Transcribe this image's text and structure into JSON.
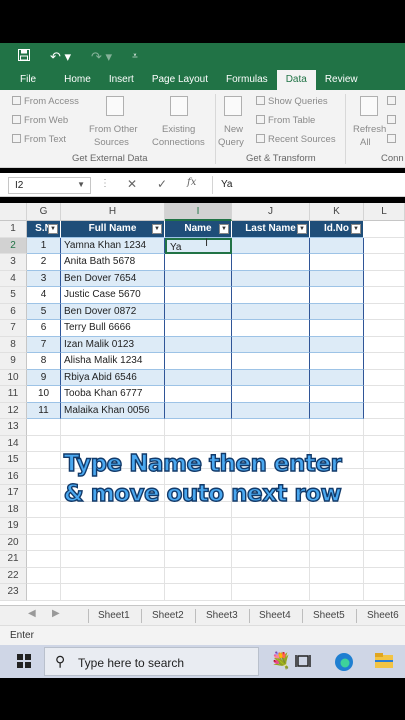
{
  "quick_access": {
    "save_icon": "save-icon",
    "undo_icon": "undo-icon",
    "redo_icon": "redo-icon",
    "customize_icon": "customize-qat-icon"
  },
  "tabs": [
    "File",
    "Home",
    "Insert",
    "Page Layout",
    "Formulas",
    "Data",
    "Review"
  ],
  "active_tab": "Data",
  "ribbon": {
    "get_external": {
      "from_access": "From Access",
      "from_web": "From Web",
      "from_text": "From Text",
      "from_other_1": "From Other",
      "from_other_2": "Sources",
      "existing_1": "Existing",
      "existing_2": "Connections",
      "label": "Get External Data"
    },
    "transform": {
      "new_1": "New",
      "new_2": "Query",
      "show_queries": "Show Queries",
      "from_table": "From Table",
      "recent_sources": "Recent Sources",
      "label": "Get & Transform"
    },
    "connections": {
      "refresh_1": "Refresh",
      "refresh_2": "All",
      "label": "Conn"
    }
  },
  "formula_bar": {
    "name_box": "I2",
    "value": "Ya",
    "cancel_icon": "cancel-icon",
    "enter_icon": "check-icon",
    "fx_icon": "fx-icon"
  },
  "columns": [
    "G",
    "H",
    "I",
    "J",
    "K",
    "L"
  ],
  "selected_column": "I",
  "table": {
    "headers": [
      "S.N",
      "Full Name",
      "Name",
      "Last Name",
      "Id.No"
    ],
    "rows": [
      [
        "1",
        "Yamna Khan 1234"
      ],
      [
        "2",
        "Anita Bath 5678"
      ],
      [
        "3",
        "Ben Dover 7654"
      ],
      [
        "4",
        "Justic Case 5670"
      ],
      [
        "5",
        "Ben Dover 0872"
      ],
      [
        "6",
        "Terry Bull 6666"
      ],
      [
        "7",
        "Izan Malik 0123"
      ],
      [
        "8",
        "Alisha Malik 1234"
      ],
      [
        "9",
        "Rbiya Abid 6546"
      ],
      [
        "10",
        "Tooba Khan 6777"
      ],
      [
        "11",
        "Malaika Khan 0056"
      ]
    ],
    "editing_value": "Ya"
  },
  "row_numbers": [
    "1",
    "2",
    "3",
    "4",
    "5",
    "6",
    "7",
    "8",
    "9",
    "10",
    "11",
    "12",
    "13",
    "14",
    "15",
    "16",
    "17",
    "18",
    "19",
    "20",
    "21",
    "22",
    "23"
  ],
  "selected_row": "2",
  "overlay": {
    "line1": "Type Name then enter",
    "line2": "& move outo next row"
  },
  "sheets": [
    "Sheet1",
    "Sheet2",
    "Sheet3",
    "Sheet4",
    "Sheet5",
    "Sheet6"
  ],
  "status": "Enter",
  "taskbar": {
    "search_placeholder": "Type here to search",
    "colors": {
      "edge": "#1f7fd1",
      "explorer": "#f3c443"
    }
  },
  "colors": {
    "excel_green": "#217346",
    "table_header": "#1f4e79",
    "band": "#ddebf7",
    "overlay_text": "#4aa8f0"
  }
}
